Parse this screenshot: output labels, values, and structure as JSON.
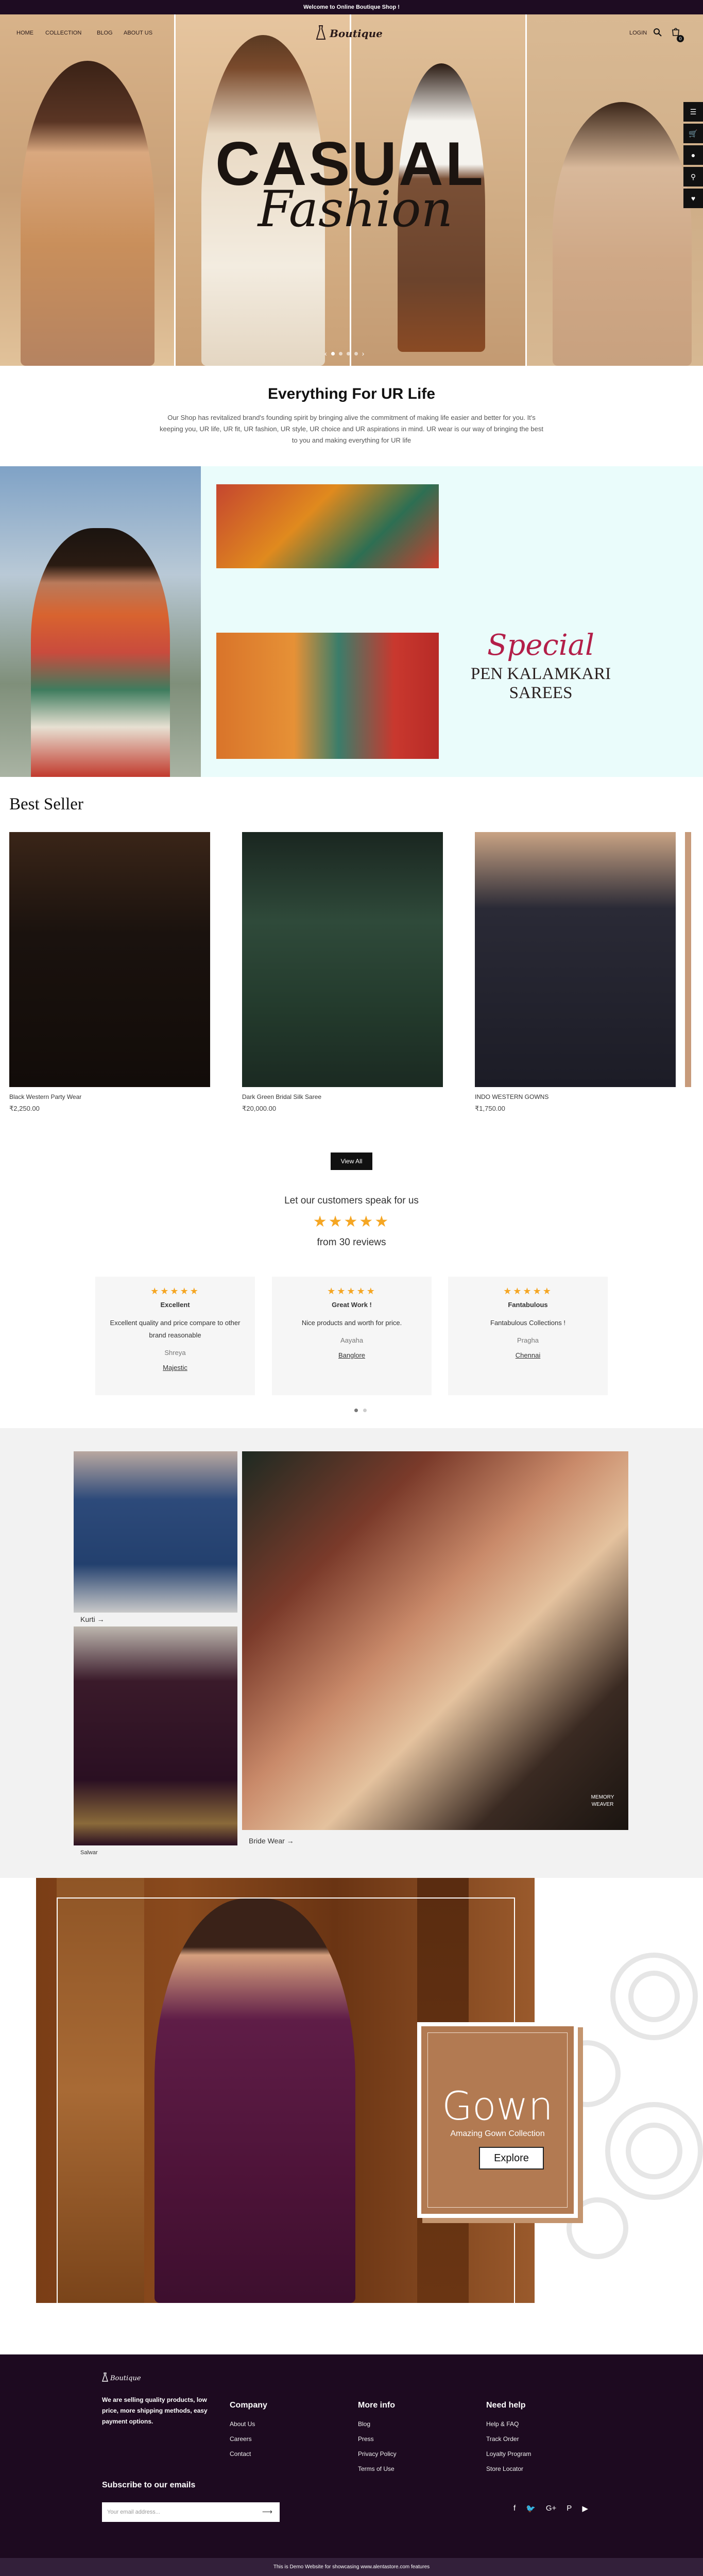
{
  "topbar": {
    "message": "Welcome to Online Boutique Shop !"
  },
  "nav": {
    "items": [
      "HOME",
      "COLLECTION",
      "BLOG",
      "ABOUT US"
    ],
    "logo_text": "Boutique",
    "login": "LOGIN",
    "cart_count": "0"
  },
  "hero": {
    "title_line1": "CASUAL",
    "title_line2": "Fashion",
    "slide_count": 4,
    "active_slide": 1
  },
  "intro": {
    "heading": "Everything For UR Life",
    "body": "Our Shop has revitalized brand's founding spirit by bringing alive the commitment of making life easier and better for you. It's keeping you, UR life, UR fit, UR fashion, UR style, UR choice and UR aspirations in mind. UR wear is our way of bringing the best to you and making everything for UR life"
  },
  "kalamkari": {
    "special": "Special",
    "subtitle": "PEN KALAMKARI SAREES"
  },
  "best_seller": {
    "heading": "Best Seller",
    "products": [
      {
        "name": "Black Western Party Wear",
        "price": "₹2,250.00",
        "color": "#2c1f1a"
      },
      {
        "name": "Dark Green Bridal Silk Saree",
        "price": "₹20,000.00",
        "color": "#1f3a2b"
      },
      {
        "name": "INDO WESTERN GOWNS",
        "price": "₹1,750.00",
        "color": "#22232d"
      }
    ],
    "view_all": "View All"
  },
  "reviews": {
    "heading": "Let our customers speak for us",
    "stars": "★★★★★",
    "count_text": "from 30 reviews",
    "items": [
      {
        "stars": "★★★★★",
        "title": "Excellent",
        "body": "Excellent quality and price compare to other brand reasonable",
        "author": "Shreya",
        "product": "Majestic"
      },
      {
        "stars": "★★★★★",
        "title": "Great Work !",
        "body": "Nice products and worth for price.",
        "author": "Aayaha",
        "product": "Banglore"
      },
      {
        "stars": "★★★★★",
        "title": "Fantabulous",
        "body": "Fantabulous Collections !",
        "author": "Pragha",
        "product": "Chennai"
      }
    ]
  },
  "collections": {
    "kurti": "Kurti →",
    "salwar": "Salwar",
    "bride_wear": "Bride Wear →",
    "watermark": "MEMORY WEAVER"
  },
  "gown": {
    "title": "Gown",
    "subtitle": "Amazing Gown Collection",
    "button": "Explore"
  },
  "footer": {
    "logo_text": "Boutique",
    "about": "We are selling quality products, low price, more shipping methods, easy payment options.",
    "company": {
      "heading": "Company",
      "links": [
        "About Us",
        "Careers",
        "Contact"
      ]
    },
    "more_info": {
      "heading": "More info",
      "links": [
        "Blog",
        "Press",
        "Privacy Policy",
        "Terms of Use"
      ]
    },
    "need_help": {
      "heading": "Need help",
      "links": [
        "Help & FAQ",
        "Track Order",
        "Loyalty Program",
        "Store Locator"
      ]
    },
    "subscribe_heading": "Subscribe to our emails",
    "email_placeholder": "Your email address...",
    "social": [
      "f",
      "🐦",
      "G+",
      "P",
      "▶"
    ],
    "bottom_text": "This is Demo Website for showcasing www.alentastore.com features"
  }
}
